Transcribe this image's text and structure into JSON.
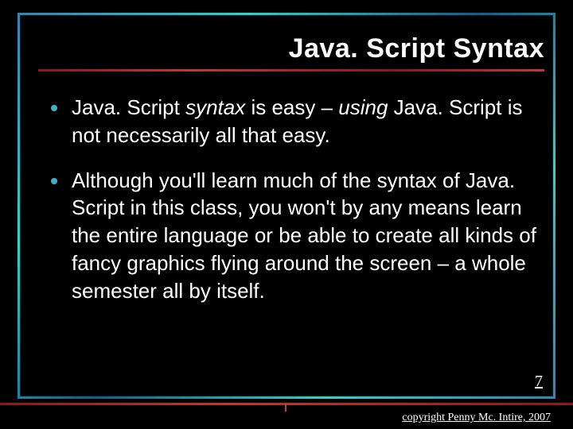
{
  "title": "Java. Script Syntax",
  "bullets": [
    {
      "pre": "Java. Script ",
      "it1": "syntax",
      "mid": " is easy – ",
      "it2": "using",
      "post": " Java. Script is not necessarily all that easy."
    },
    {
      "plain": "Although you'll learn much of the syntax of Java. Script in this class, you won't by any means learn the entire language or be able to create all kinds of fancy graphics flying around the screen – a whole semester all by itself."
    }
  ],
  "page_number": "7",
  "copyright": "copyright Penny Mc. Intire, 2007"
}
